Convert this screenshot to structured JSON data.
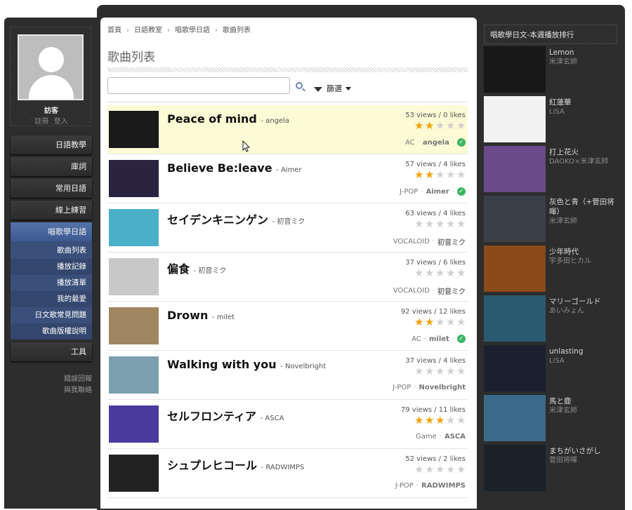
{
  "user": {
    "name": "訪客",
    "register": "註冊",
    "login": "登入"
  },
  "nav": {
    "items": [
      "日語教學",
      "庫詞",
      "常用日語",
      "線上練習",
      "唱歌學日語"
    ],
    "sub": [
      "歌曲列表",
      "播放記錄",
      "播放清單",
      "我的最愛",
      "日文歌常見問題",
      "歌曲版權說明"
    ],
    "tools": "工具"
  },
  "links": {
    "report": "錯誤回報",
    "contact": "與我聯絡"
  },
  "breadcrumb": [
    "首頁",
    "日語教室",
    "唱歌學日語",
    "歌曲列表"
  ],
  "page": {
    "title": "歌曲列表",
    "search_placeholder": "",
    "filter_label": "篩選"
  },
  "songs": [
    {
      "title": "Peace of mind",
      "artist": "- angela",
      "stats": "53 views / 0 likes",
      "rating": 2,
      "genre": "AC",
      "singer": "angela",
      "verified": true,
      "color": "#1a1a1a"
    },
    {
      "title": "Believe Be:leave",
      "artist": "- Aimer",
      "stats": "57 views / 4 likes",
      "rating": 2,
      "genre": "J-POP",
      "singer": "Aimer",
      "verified": true,
      "color": "#2a2440"
    },
    {
      "title": "セイデンキニンゲン",
      "artist": "- 初音ミク",
      "stats": "63 views / 4 likes",
      "rating": 0,
      "genre": "VOCALOID",
      "singer": "初音ミク",
      "verified": false,
      "color": "#4ab0c8"
    },
    {
      "title": "偏食",
      "artist": "- 初音ミク",
      "stats": "37 views / 6 likes",
      "rating": 0,
      "genre": "VOCALOID",
      "singer": "初音ミク",
      "verified": false,
      "color": "#c8c8c8"
    },
    {
      "title": "Drown",
      "artist": "- milet",
      "stats": "92 views / 12 likes",
      "rating": 2,
      "genre": "AC",
      "singer": "milet",
      "verified": true,
      "color": "#a08660"
    },
    {
      "title": "Walking with you",
      "artist": "- Novelbright",
      "stats": "37 views / 4 likes",
      "rating": 0,
      "genre": "J-POP",
      "singer": "Novelbright",
      "verified": false,
      "color": "#7aa0b0"
    },
    {
      "title": "セルフロンティア",
      "artist": "- ASCA",
      "stats": "79 views / 11 likes",
      "rating": 3,
      "genre": "Game",
      "singer": "ASCA",
      "verified": false,
      "color": "#4b3aa0"
    },
    {
      "title": "シュプレヒコール",
      "artist": "- RADWIMPS",
      "stats": "52 views / 2 likes",
      "rating": 0,
      "genre": "J-POP",
      "singer": "RADWIMPS",
      "verified": false,
      "color": "#222"
    }
  ],
  "ranking": {
    "title": "唱歌學日文-本週播放排行",
    "items": [
      {
        "title": "Lemon",
        "artist": "米津玄師",
        "color": "#181818"
      },
      {
        "title": "紅蓮華",
        "artist": "LiSA",
        "color": "#f2f2f2"
      },
      {
        "title": "打上花火",
        "artist": "DAOKO×米津玄師",
        "color": "#6a4a8a"
      },
      {
        "title": "灰色と青（+菅田将暉）",
        "artist": "米津玄師",
        "color": "#3a3f48"
      },
      {
        "title": "少年時代",
        "artist": "宇多田ヒカル",
        "color": "#8a4a1a"
      },
      {
        "title": "マリーゴールド",
        "artist": "あいみょん",
        "color": "#2a5a70"
      },
      {
        "title": "unlasting",
        "artist": "LiSA",
        "color": "#1a2030"
      },
      {
        "title": "馬と鹿",
        "artist": "米津玄師",
        "color": "#3a6a8a"
      },
      {
        "title": "まちがいさがし",
        "artist": "菅田将暉",
        "color": "#1a2228"
      }
    ]
  }
}
